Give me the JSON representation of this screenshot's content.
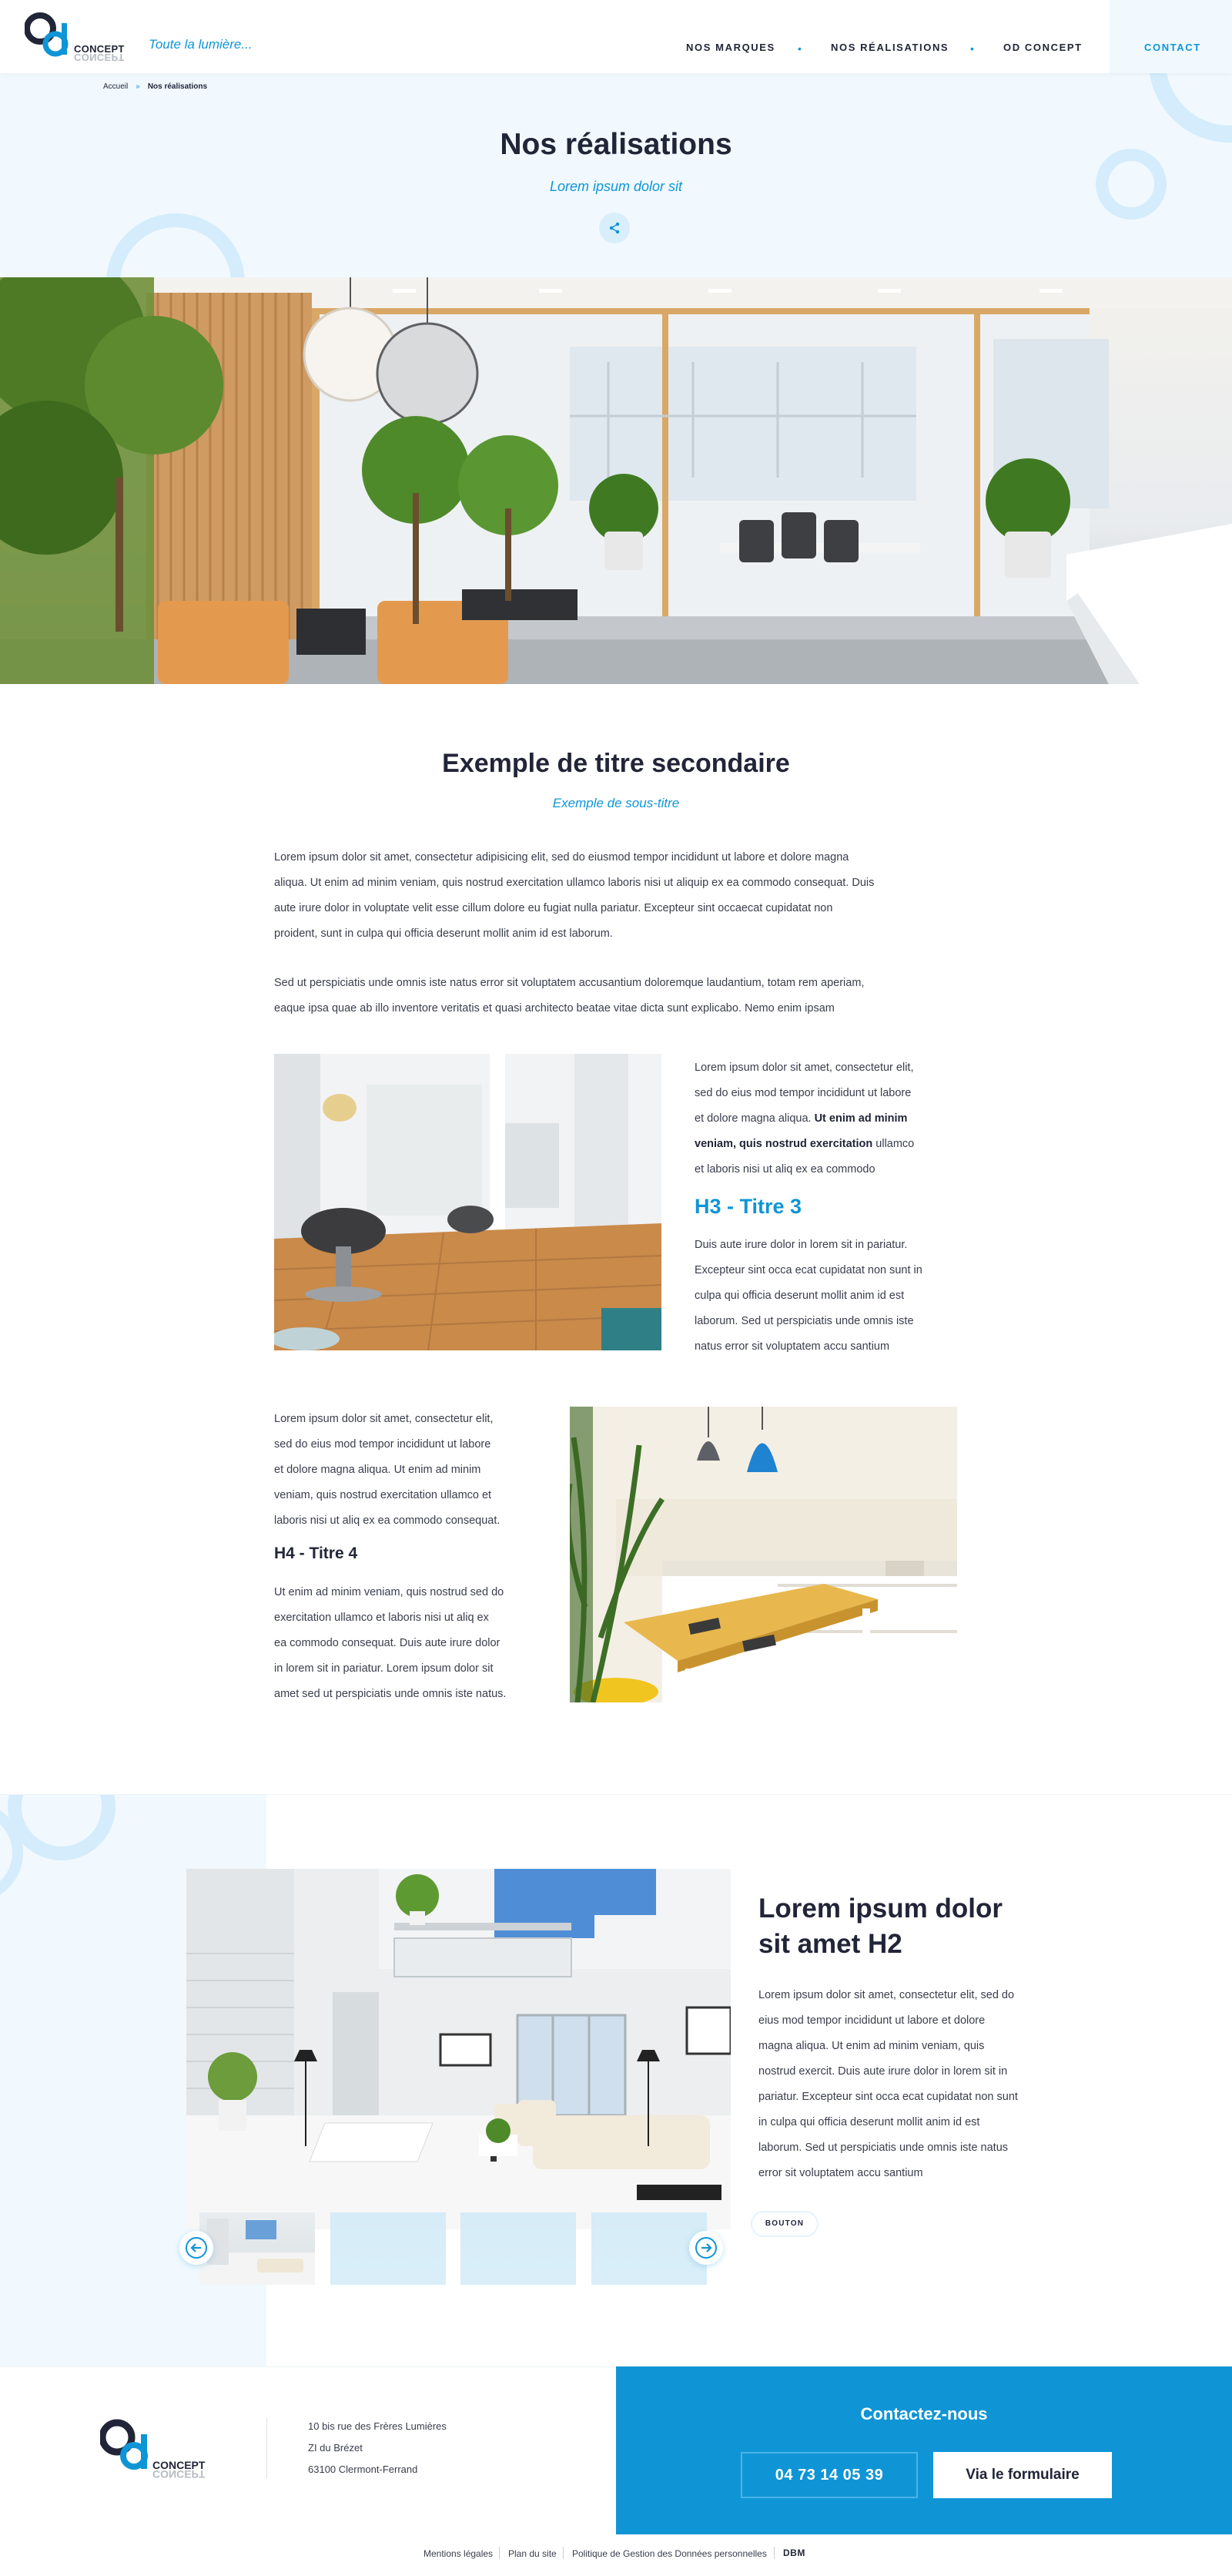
{
  "header": {
    "brand_top": "CONCEPT",
    "brand_bottom": "CONCEPT",
    "tagline": "Toute la lumière...",
    "nav": [
      {
        "label": "NOS MARQUES"
      },
      {
        "label": "NOS RÉALISATIONS"
      },
      {
        "label": "OD CONCEPT"
      }
    ],
    "nav_separator": "•",
    "contact_label": "CONTACT"
  },
  "breadcrumb": {
    "home": "Accueil",
    "separator": "»",
    "current": "Nos réalisations"
  },
  "hero": {
    "title": "Nos réalisations",
    "subtitle": "Lorem ipsum dolor sit",
    "share_icon": "share-icon"
  },
  "content": {
    "title": "Exemple de titre secondaire",
    "subtitle": "Exemple de sous-titre",
    "intro_lines": [
      "Lorem ipsum dolor sit amet, consectetur adipisicing elit, sed do eiusmod tempor incididunt ut labore et dolore magna",
      "aliqua. Ut enim ad minim veniam, quis nostrud exercitation ullamco laboris nisi ut aliquip ex ea commodo consequat. Duis",
      "aute irure dolor in voluptate velit esse cillum dolore eu fugiat nulla pariatur. Excepteur sint occaecat cupidatat non",
      "proident, sunt in culpa qui officia deserunt mollit anim id est laborum."
    ],
    "second_lines": [
      "Sed ut perspiciatis unde omnis iste natus error sit voluptatem accusantium doloremque laudantium, totam rem aperiam,",
      "eaque ipsa quae ab illo inventore veritatis et quasi architecto beatae vitae dicta sunt explicabo. Nemo enim ipsam"
    ],
    "block1": {
      "lines": [
        "Lorem ipsum dolor sit amet, consectetur elit,",
        "sed do eius mod tempor incididunt ut labore",
        "et dolore magna aliqua. ",
        "veniam, quis nostrud exercitation",
        "et laboris nisi ut aliq ex ea commodo"
      ],
      "bold_a": "Ut enim ad minim",
      "tail_b": " ullamco",
      "h3": "H3 - Titre 3",
      "after_lines": [
        "Duis aute irure dolor in lorem sit in pariatur.",
        "Excepteur sint occa ecat cupidatat non sunt in",
        "culpa qui officia deserunt mollit anim id est",
        "laborum. Sed ut perspiciatis unde omnis iste",
        "natus error sit voluptatem accu santium"
      ]
    },
    "block2": {
      "lines": [
        "Lorem ipsum dolor sit amet, consectetur elit,",
        "sed do eius mod tempor incididunt ut labore",
        "et dolore magna aliqua. Ut enim ad minim",
        "veniam, quis nostrud exercitation ullamco et",
        "laboris nisi ut aliq ex ea commodo consequat."
      ],
      "h4": "H4 - Titre 4",
      "after_lines": [
        "Ut enim ad minim veniam, quis nostrud sed do",
        "exercitation ullamco et laboris nisi ut aliq ex",
        "ea commodo consequat. Duis aute irure dolor",
        "in lorem sit in pariatur. Lorem ipsum dolor sit",
        "amet sed ut perspiciatis unde omnis iste natus."
      ]
    }
  },
  "slider": {
    "title_line1": "Lorem ipsum dolor",
    "title_line2": "sit amet H2",
    "lines": [
      "Lorem ipsum dolor sit amet, consectetur elit, sed do",
      "eius mod tempor incididunt ut labore et dolore",
      "magna aliqua. Ut enim ad minim veniam, quis",
      "nostrud exercit. Duis aute irure dolor in lorem sit in",
      "pariatur. Excepteur sint occa ecat cupidatat non sunt",
      "in culpa qui officia deserunt mollit anim id est",
      "laborum. Sed ut perspiciatis unde omnis iste natus",
      "error sit voluptatem accu santium"
    ],
    "button": "BOUTON",
    "prev_icon": "arrow-left-icon",
    "next_icon": "arrow-right-icon"
  },
  "footer": {
    "brand_top": "CONCEPT",
    "brand_bottom": "CONCEPT",
    "address": [
      "10 bis rue des Frères Lumières",
      "ZI du Brézet",
      "63100 Clermont-Ferrand"
    ],
    "contact_title": "Contactez-nous",
    "phone": "04 73 14 05 39",
    "form_button": "Via le formulaire",
    "legal_links": [
      "Mentions légales",
      "Plan du site",
      "Politique de Gestion des Données personnelles"
    ],
    "credit": "DBM"
  },
  "colors": {
    "accent": "#0f95d6",
    "dark": "#222538",
    "light_band": "#f1f9fe"
  }
}
